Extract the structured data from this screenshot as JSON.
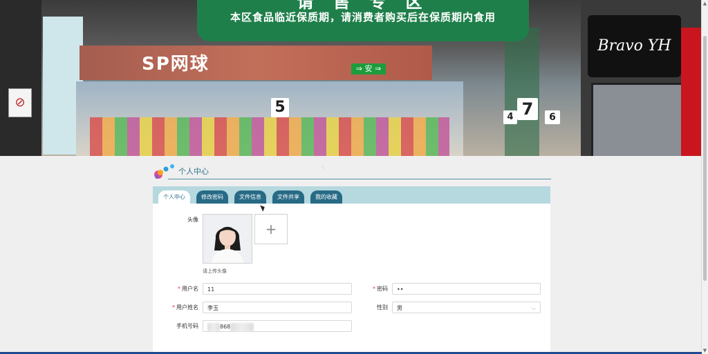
{
  "banner": {
    "sign_title": "请 售 专 区",
    "sign_subtitle": "本区食品临近保质期，请消费者购买后在保质期内食用",
    "store_name": "SP网球",
    "brand": "Bravo YH",
    "exit_sign": "⇒ 安 ⇒",
    "numbers": [
      "5",
      "4",
      "7",
      "6"
    ]
  },
  "section": {
    "title": "个人中心"
  },
  "tabs": [
    {
      "label": "个人中心",
      "active": true
    },
    {
      "label": "修改密码",
      "active": false
    },
    {
      "label": "文件信息",
      "active": false
    },
    {
      "label": "文件共享",
      "active": false
    },
    {
      "label": "我的收藏",
      "active": false
    }
  ],
  "form": {
    "avatar_label": "头像",
    "upload_hint": "请上传头像",
    "username_label": "用户名",
    "username_value": "11",
    "password_label": "密码",
    "password_value": "••",
    "realname_label": "用户姓名",
    "realname_value": "李玉",
    "gender_label": "性别",
    "gender_value": "男",
    "phone_label": "手机号码",
    "phone_value_partial": "868"
  },
  "colors": {
    "accent": "#276a86",
    "tab_bar": "#b6d8df",
    "title": "#2d6f8a"
  }
}
